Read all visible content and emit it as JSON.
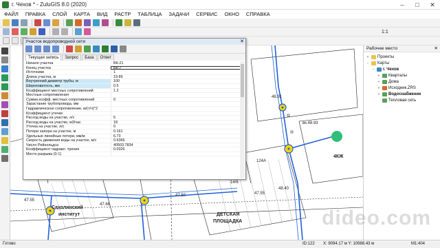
{
  "window": {
    "title": "г. Чехов * - ZuluGIS 8.0 (2020)",
    "buttons": [
      "–",
      "□",
      "✕"
    ]
  },
  "menu": [
    "ФАЙЛ",
    "ПРАВКА",
    "СЛОЙ",
    "КАРТА",
    "ВИД",
    "РАСТР",
    "ТАБЛИЦА",
    "ЗАДАЧИ",
    "СЕРВИС",
    "ОКНО",
    "СПРАВКА"
  ],
  "toolbar": {
    "scale_label": "1:1"
  },
  "colors": {
    "pipe": "#1f5fd6",
    "node_fill": "#ffd400",
    "highlight": "#cbe9f7",
    "marker": "#2fbf7a"
  },
  "dialog": {
    "title": "Участок водопроводной сети",
    "close": "✕",
    "tabs": [
      "Текущая запись",
      "Запрос",
      "База",
      "Ответ"
    ],
    "rows": [
      {
        "name": "Начало участка",
        "value": "ВК-21"
      },
      {
        "name": "Конец участка",
        "value": "ВК-7"
      },
      {
        "name": "Источники",
        "value": "1"
      },
      {
        "name": "Длина участка, м",
        "value": "19.89"
      },
      {
        "name": "Внутренний диаметр трубы, м",
        "value": "100"
      },
      {
        "name": "Шероховатость, мм",
        "value": "0.5"
      },
      {
        "name": "Коэффициент местных сопротивлений",
        "value": "1.2"
      },
      {
        "name": "Местные сопротивления",
        "value": ""
      },
      {
        "name": "Сумма коэфф. местных сопротивлений",
        "value": "0"
      },
      {
        "name": "Зарастание трубопровода, мм",
        "value": ""
      },
      {
        "name": "Гидравлическое сопротивление, м/(т/ч)^2",
        "value": ""
      },
      {
        "name": "Коэффициент утечки",
        "value": ""
      },
      {
        "name": "Расход воды на участке, л/с",
        "value": "5"
      },
      {
        "name": "Расход воды на участке, м3/час",
        "value": "18"
      },
      {
        "name": "Утечка на участке, л/с",
        "value": "0"
      },
      {
        "name": "Потери напора на участке, м",
        "value": "0.161"
      },
      {
        "name": "Удельные линейные потери, мм/м",
        "value": "6.73"
      },
      {
        "name": "Скорость движения воды на участке, м/с",
        "value": "0.6366"
      },
      {
        "name": "Число Рейнольдса",
        "value": "40503.7834"
      },
      {
        "name": "Коэффициент гидравл. трения",
        "value": "0.0326"
      },
      {
        "name": "Место разрыва (0-1)",
        "value": ""
      }
    ]
  },
  "panel": {
    "title": "Рабочее место",
    "pin": "✕",
    "tree": [
      {
        "label": "Проекты",
        "depth": 0,
        "exp": "+",
        "icon": "folder"
      },
      {
        "label": "Карты",
        "depth": 0,
        "exp": "−",
        "icon": "folder"
      },
      {
        "label": "г. Чехов",
        "depth": 1,
        "exp": "−",
        "icon": "map",
        "bold": true
      },
      {
        "label": "Кварталы",
        "depth": 2,
        "exp": "+",
        "icon": "layer"
      },
      {
        "label": "Дома",
        "depth": 2,
        "exp": "+",
        "icon": "layer"
      },
      {
        "label": "Исходник.ZRS",
        "depth": 2,
        "exp": "+",
        "icon": "raster"
      },
      {
        "label": "Водоснабжение",
        "depth": 2,
        "exp": "+",
        "icon": "layer",
        "bold": true
      },
      {
        "label": "Тепловая сеть",
        "depth": 2,
        "exp": "",
        "icon": "layer"
      }
    ]
  },
  "map": {
    "labels": [
      {
        "text": "Сахолинский",
        "big": true
      },
      {
        "text": "институт",
        "big": true
      },
      {
        "text": "ДЕТСКАЯ",
        "big": true
      },
      {
        "text": "ПЛОЩАДКА",
        "big": true
      },
      {
        "text": "4КЖ",
        "big": true
      },
      {
        "text": "124А"
      },
      {
        "text": "14/6"
      },
      {
        "text": "47.55"
      },
      {
        "text": "47.66"
      },
      {
        "text": "47.50"
      },
      {
        "text": "47.55"
      },
      {
        "text": "48.40"
      },
      {
        "text": "48.91"
      },
      {
        "text": "вк.48.93"
      }
    ]
  },
  "watermark": "dideo.com",
  "status": {
    "ready": "Готово",
    "id": "ID:122",
    "coords": "X: 9094.17 м Y: 10988.43 м",
    "scale": "M1:404"
  }
}
